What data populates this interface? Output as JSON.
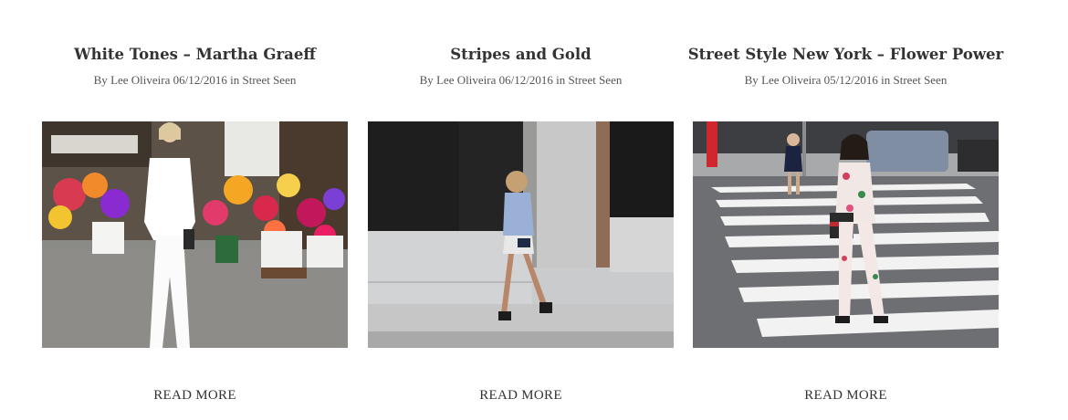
{
  "posts": [
    {
      "title": "White Tones – Martha Graeff",
      "by_label": "By",
      "author": "Lee Oliveira",
      "date": "06/12/2016",
      "in_label": "in",
      "category": "Street Seen",
      "read_more": "READ MORE"
    },
    {
      "title": "Stripes and Gold",
      "by_label": "By",
      "author": "Lee Oliveira",
      "date": "06/12/2016",
      "in_label": "in",
      "category": "Street Seen",
      "read_more": "READ MORE"
    },
    {
      "title": "Street Style New York – Flower Power",
      "by_label": "By",
      "author": "Lee Oliveira",
      "date": "05/12/2016",
      "in_label": "in",
      "category": "Street Seen",
      "read_more": "READ MORE"
    }
  ],
  "colors": {
    "text": "#333333",
    "meta": "#555555",
    "background": "#ffffff"
  }
}
